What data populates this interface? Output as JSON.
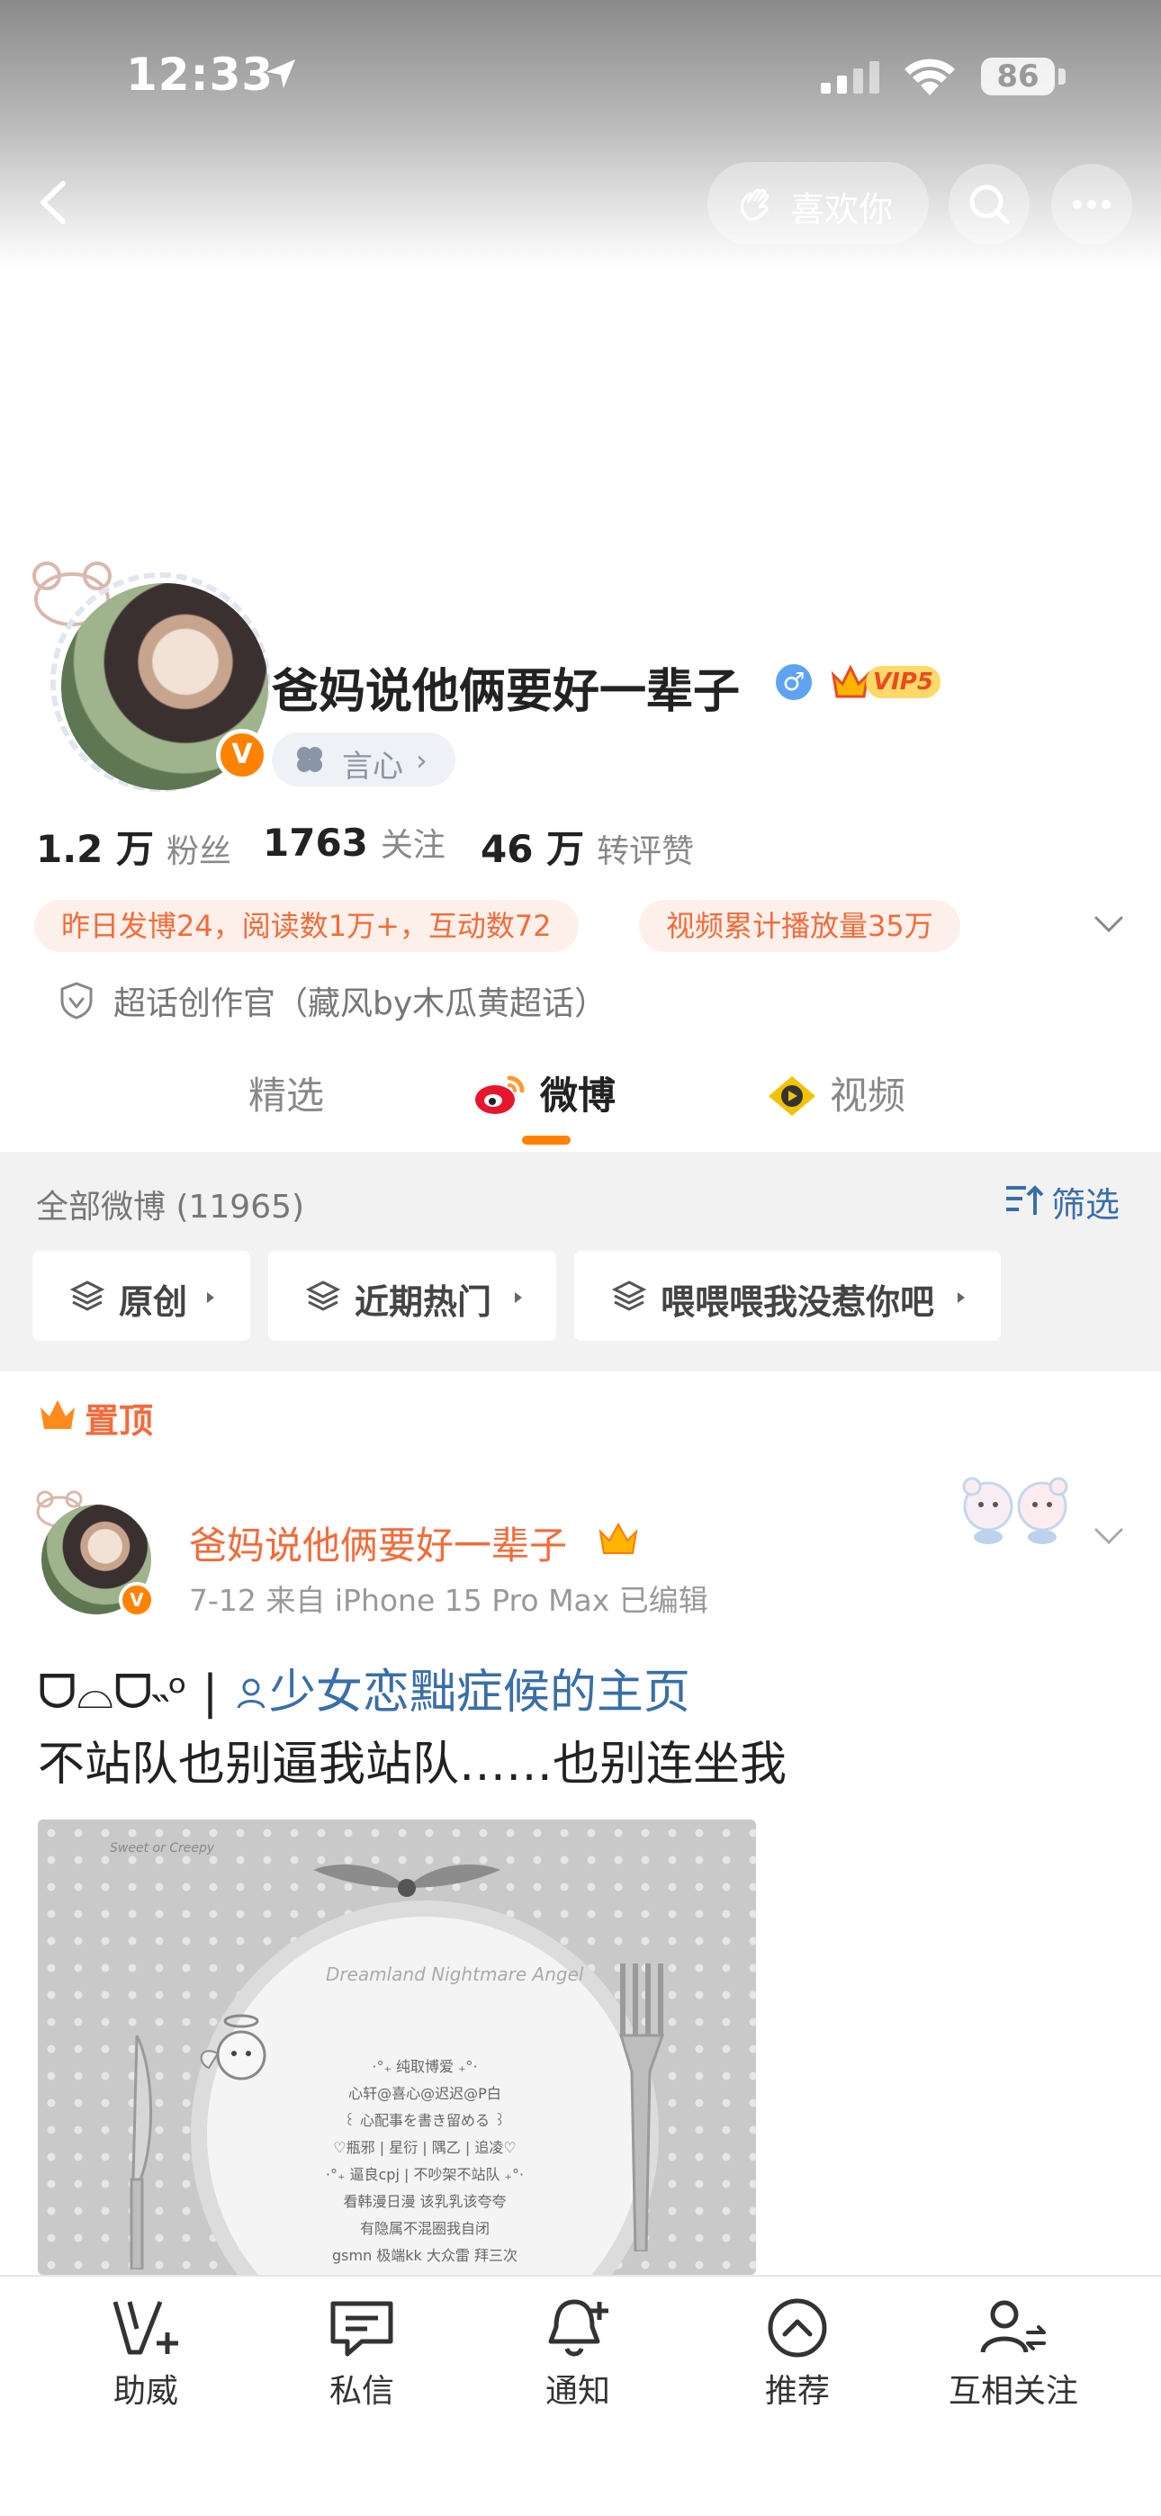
{
  "status_bar": {
    "time": "12:33",
    "battery": "86"
  },
  "header": {
    "like_label": "喜欢你"
  },
  "profile": {
    "name": "爸妈说他俩要好一辈子",
    "gender_symbol": "♂",
    "vip_label": "VIP5",
    "xinxin_label": "言心",
    "stats": [
      {
        "num": "1.2 万",
        "label": "粉丝"
      },
      {
        "num": "1763",
        "label": "关注"
      },
      {
        "num": "46 万",
        "label": "转评赞"
      }
    ],
    "tags": [
      "昨日发博24，阅读数1万+，互动数72",
      "视频累计播放量35万"
    ],
    "super_topic": "超话创作官（藏风by木瓜黄超话）"
  },
  "tabs": [
    "精选",
    "微博",
    "视频"
  ],
  "filter": {
    "all_label": "全部微博 (11965)",
    "filter_label": "筛选",
    "chips": [
      "原创",
      "近期热门",
      "喂喂喂我没惹你吧"
    ]
  },
  "pinned_label": "置顶",
  "post": {
    "author": "爸妈说他俩要好一辈子",
    "meta": "7-12  来自 iPhone 15 Pro Max  已编辑",
    "line1_prefix": "ᗜ⌓ᗜ˵ᵒ  |  ",
    "line1_link": "少女恋黜症候的主页",
    "line2": "不站队也别逼我站队……也别连坐我",
    "image": {
      "corner_label": "Sweet or Creepy",
      "title": "Dreamland Nightmare Angel",
      "lines": [
        "·°₊ 纯取博爱 ₊°·",
        "心轩@喜心@迟迟@P白",
        "꒰ 心配事を書き留める ꒱",
        "♡瓶邪 | 星衍 | 隅乙 | 追凌♡",
        "·°₊ 逼良cpj | 不吵架不站队 ₊°·",
        "看韩漫日漫 该乳乳该夸夸",
        "有隐属不混圈我自闭",
        "gsmn 极端kk 大众雷 拜三次"
      ]
    }
  },
  "bottom_bar": [
    "助威",
    "私信",
    "通知",
    "推荐",
    "互相关注"
  ]
}
